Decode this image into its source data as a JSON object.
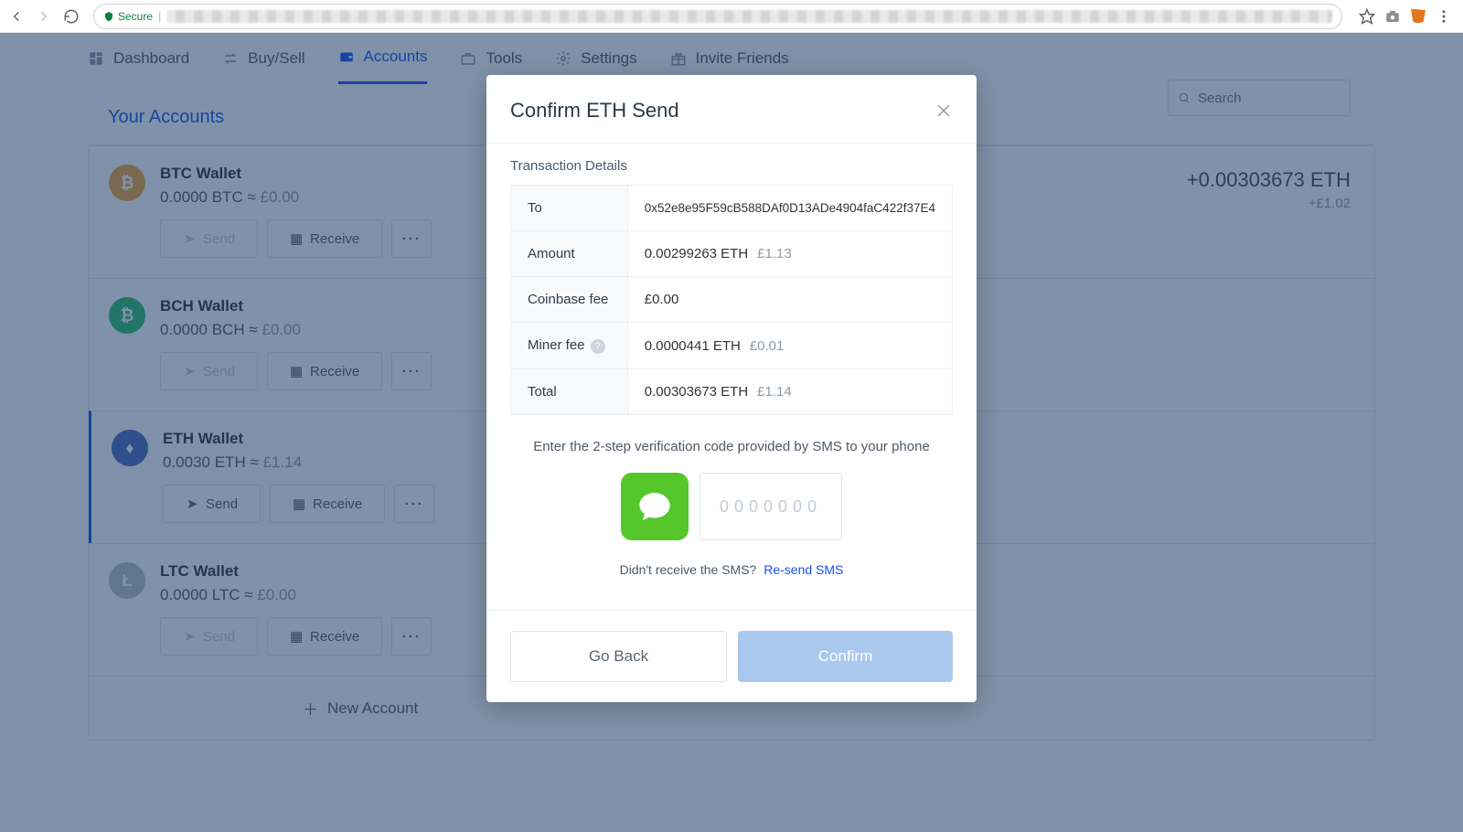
{
  "browser": {
    "secure_label": "Secure"
  },
  "nav": {
    "dashboard": "Dashboard",
    "buysell": "Buy/Sell",
    "accounts": "Accounts",
    "tools": "Tools",
    "settings": "Settings",
    "invite": "Invite Friends"
  },
  "section_title": "Your Accounts",
  "search_placeholder": "Search",
  "new_account": "New Account",
  "actions": {
    "send": "Send",
    "receive": "Receive",
    "more": "···"
  },
  "accounts": [
    {
      "name": "BTC Wallet",
      "balance": "0.0000 BTC",
      "fiat": "£0.00"
    },
    {
      "name": "BCH Wallet",
      "balance": "0.0000 BCH",
      "fiat": "£0.00"
    },
    {
      "name": "ETH Wallet",
      "balance": "0.0030 ETH",
      "fiat": "£1.14"
    },
    {
      "name": "LTC Wallet",
      "balance": "0.0000 LTC",
      "fiat": "£0.00"
    }
  ],
  "summary": {
    "amount": "+0.00303673 ETH",
    "fiat": "+£1.02"
  },
  "modal": {
    "title": "Confirm ETH Send",
    "section": "Transaction Details",
    "rows": {
      "to_label": "To",
      "to_value": "0x52e8e95F59cB588DAf0D13ADe4904faC422f37E4",
      "amount_label": "Amount",
      "amount_value": "0.00299263 ETH",
      "amount_fiat": "£1.13",
      "cbfee_label": "Coinbase fee",
      "cbfee_value": "£0.00",
      "mfee_label": "Miner fee",
      "mfee_value": "0.0000441 ETH",
      "mfee_fiat": "£0.01",
      "total_label": "Total",
      "total_value": "0.00303673 ETH",
      "total_fiat": "£1.14"
    },
    "twofa_hint": "Enter the 2-step verification code provided by SMS to your phone",
    "code_placeholder": "0000000",
    "resend_q": "Didn't receive the SMS?",
    "resend_link": "Re-send SMS",
    "go_back": "Go Back",
    "confirm": "Confirm"
  }
}
